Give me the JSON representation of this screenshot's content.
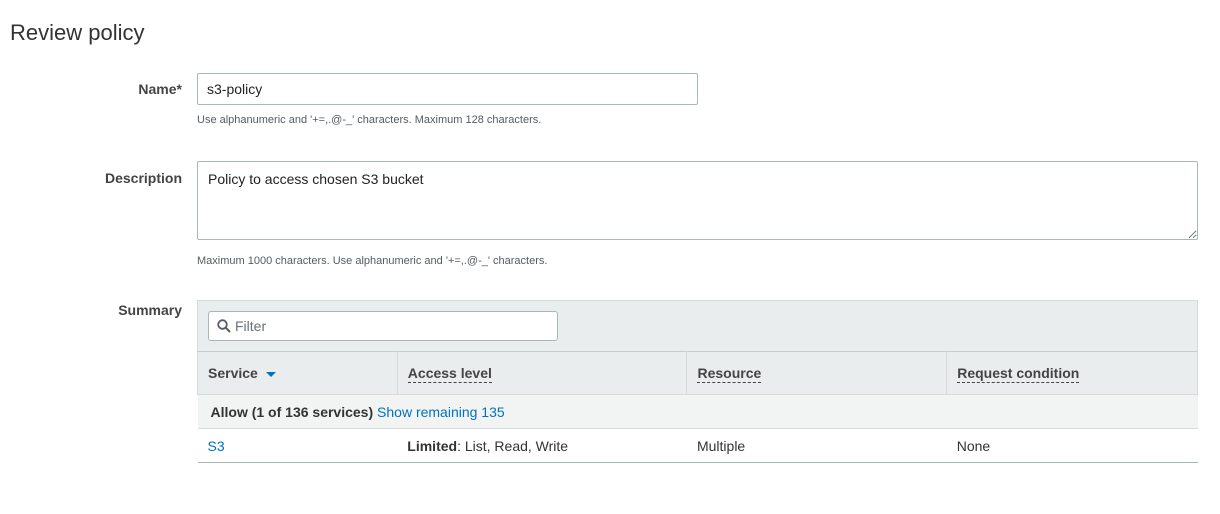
{
  "page": {
    "title": "Review policy"
  },
  "name_field": {
    "label": "Name*",
    "value": "s3-policy",
    "hint": "Use alphanumeric and '+=,.@-_' characters. Maximum 128 characters."
  },
  "description_field": {
    "label": "Description",
    "value": "Policy to access chosen S3 bucket",
    "hint": "Maximum 1000 characters. Use alphanumeric and '+=,.@-_' characters."
  },
  "summary": {
    "label": "Summary",
    "filter_placeholder": "Filter",
    "columns": [
      "Service",
      "Access level",
      "Resource",
      "Request condition"
    ],
    "group": {
      "label": "Allow (1 of 136 services)",
      "link": "Show remaining 135"
    },
    "rows": [
      {
        "service": "S3",
        "access_level_strong": "Limited",
        "access_level_rest": ": List, Read, Write",
        "resource": "Multiple",
        "request_condition": "None"
      }
    ]
  },
  "colors": {
    "link": "#0073bb",
    "header_bg": "#eaeded",
    "group_bg": "#f2f3f3"
  }
}
